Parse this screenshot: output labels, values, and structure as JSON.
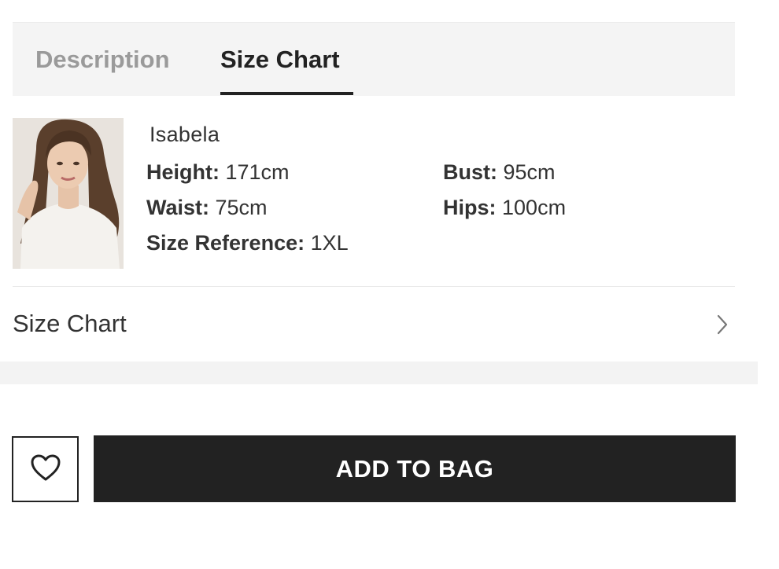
{
  "tabs": [
    {
      "label": "Description",
      "active": false
    },
    {
      "label": "Size Chart",
      "active": true
    }
  ],
  "model": {
    "name": "Isabela",
    "stats": {
      "height": {
        "key": "Height:",
        "value": "171cm"
      },
      "waist": {
        "key": "Waist:",
        "value": "75cm"
      },
      "size_reference": {
        "key": "Size Reference:",
        "value": "1XL"
      },
      "bust": {
        "key": "Bust:",
        "value": "95cm"
      },
      "hips": {
        "key": "Hips:",
        "value": "100cm"
      }
    }
  },
  "size_chart_row": {
    "label": "Size Chart",
    "icon": "chevron-right-icon"
  },
  "actions": {
    "wishlist_icon": "heart-icon",
    "add_to_bag": "ADD TO BAG"
  },
  "colors": {
    "primary": "#222222",
    "tab_bg": "#f4f4f4",
    "inactive_tab": "#9a9a9a"
  }
}
